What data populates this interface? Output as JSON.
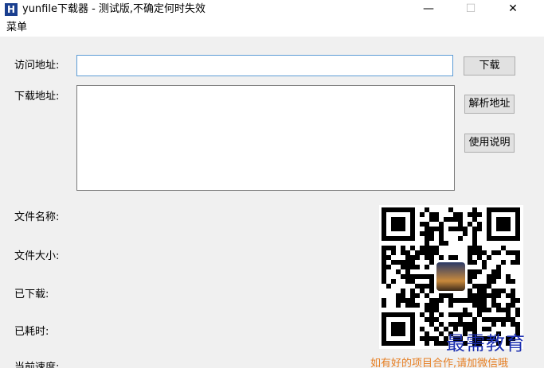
{
  "window": {
    "title": "yunfile下载器 - 测试版,不确定何时失效",
    "icon_letter": "H",
    "minimize_glyph": "—",
    "maximize_glyph": "☐",
    "close_glyph": "✕"
  },
  "menu": {
    "items": [
      {
        "label": "菜单"
      }
    ]
  },
  "form": {
    "url_label": "访问地址:",
    "url_value": "",
    "download_label": "下载地址:",
    "download_value": "",
    "filename_label": "文件名称:",
    "filesize_label": "文件大小:",
    "downloaded_label": "已下载:",
    "elapsed_label": "已耗时:",
    "speed_label": "当前速度:"
  },
  "buttons": {
    "download": "下载",
    "parse": "解析地址",
    "help": "使用说明"
  },
  "footer": {
    "note": "如有好的项目合作,请加微信哦",
    "note_color": "#e67e22"
  },
  "watermark": {
    "text": "最需教育",
    "color": "#1c2fb0"
  },
  "colors": {
    "accent_border": "#5b9bd5",
    "button_bg": "#e1e1e1",
    "app_icon_bg": "#1a3f8f"
  }
}
